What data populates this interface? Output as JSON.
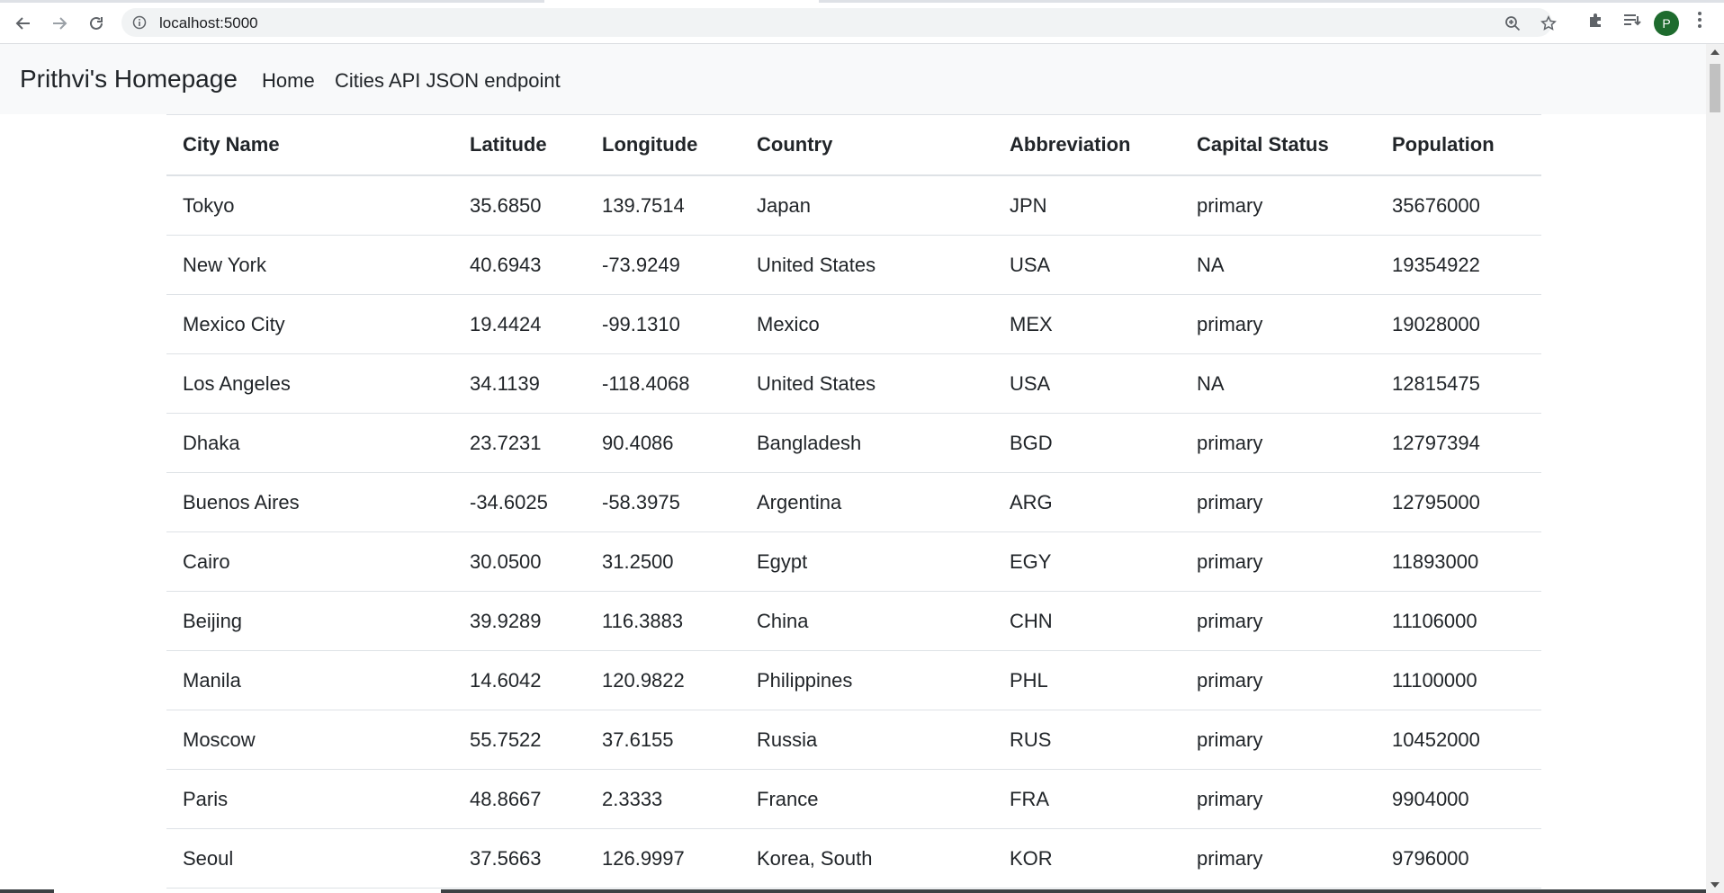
{
  "browser": {
    "url": "localhost:5000",
    "profile_initial": "P",
    "colors": {
      "avatar": "#1e6b2e",
      "omnibox": "#f1f3f4"
    }
  },
  "navbar": {
    "brand": "Prithvi's Homepage",
    "links": [
      {
        "label": "Home"
      },
      {
        "label": "Cities API JSON endpoint"
      }
    ]
  },
  "table": {
    "headers": [
      "City Name",
      "Latitude",
      "Longitude",
      "Country",
      "Abbreviation",
      "Capital Status",
      "Population"
    ],
    "rows": [
      [
        "Tokyo",
        "35.6850",
        "139.7514",
        "Japan",
        "JPN",
        "primary",
        "35676000"
      ],
      [
        "New York",
        "40.6943",
        "-73.9249",
        "United States",
        "USA",
        "NA",
        "19354922"
      ],
      [
        "Mexico City",
        "19.4424",
        "-99.1310",
        "Mexico",
        "MEX",
        "primary",
        "19028000"
      ],
      [
        "Los Angeles",
        "34.1139",
        "-118.4068",
        "United States",
        "USA",
        "NA",
        "12815475"
      ],
      [
        "Dhaka",
        "23.7231",
        "90.4086",
        "Bangladesh",
        "BGD",
        "primary",
        "12797394"
      ],
      [
        "Buenos Aires",
        "-34.6025",
        "-58.3975",
        "Argentina",
        "ARG",
        "primary",
        "12795000"
      ],
      [
        "Cairo",
        "30.0500",
        "31.2500",
        "Egypt",
        "EGY",
        "primary",
        "11893000"
      ],
      [
        "Beijing",
        "39.9289",
        "116.3883",
        "China",
        "CHN",
        "primary",
        "11106000"
      ],
      [
        "Manila",
        "14.6042",
        "120.9822",
        "Philippines",
        "PHL",
        "primary",
        "11100000"
      ],
      [
        "Moscow",
        "55.7522",
        "37.6155",
        "Russia",
        "RUS",
        "primary",
        "10452000"
      ],
      [
        "Paris",
        "48.8667",
        "2.3333",
        "France",
        "FRA",
        "primary",
        "9904000"
      ],
      [
        "Seoul",
        "37.5663",
        "126.9997",
        "Korea, South",
        "KOR",
        "primary",
        "9796000"
      ]
    ]
  }
}
